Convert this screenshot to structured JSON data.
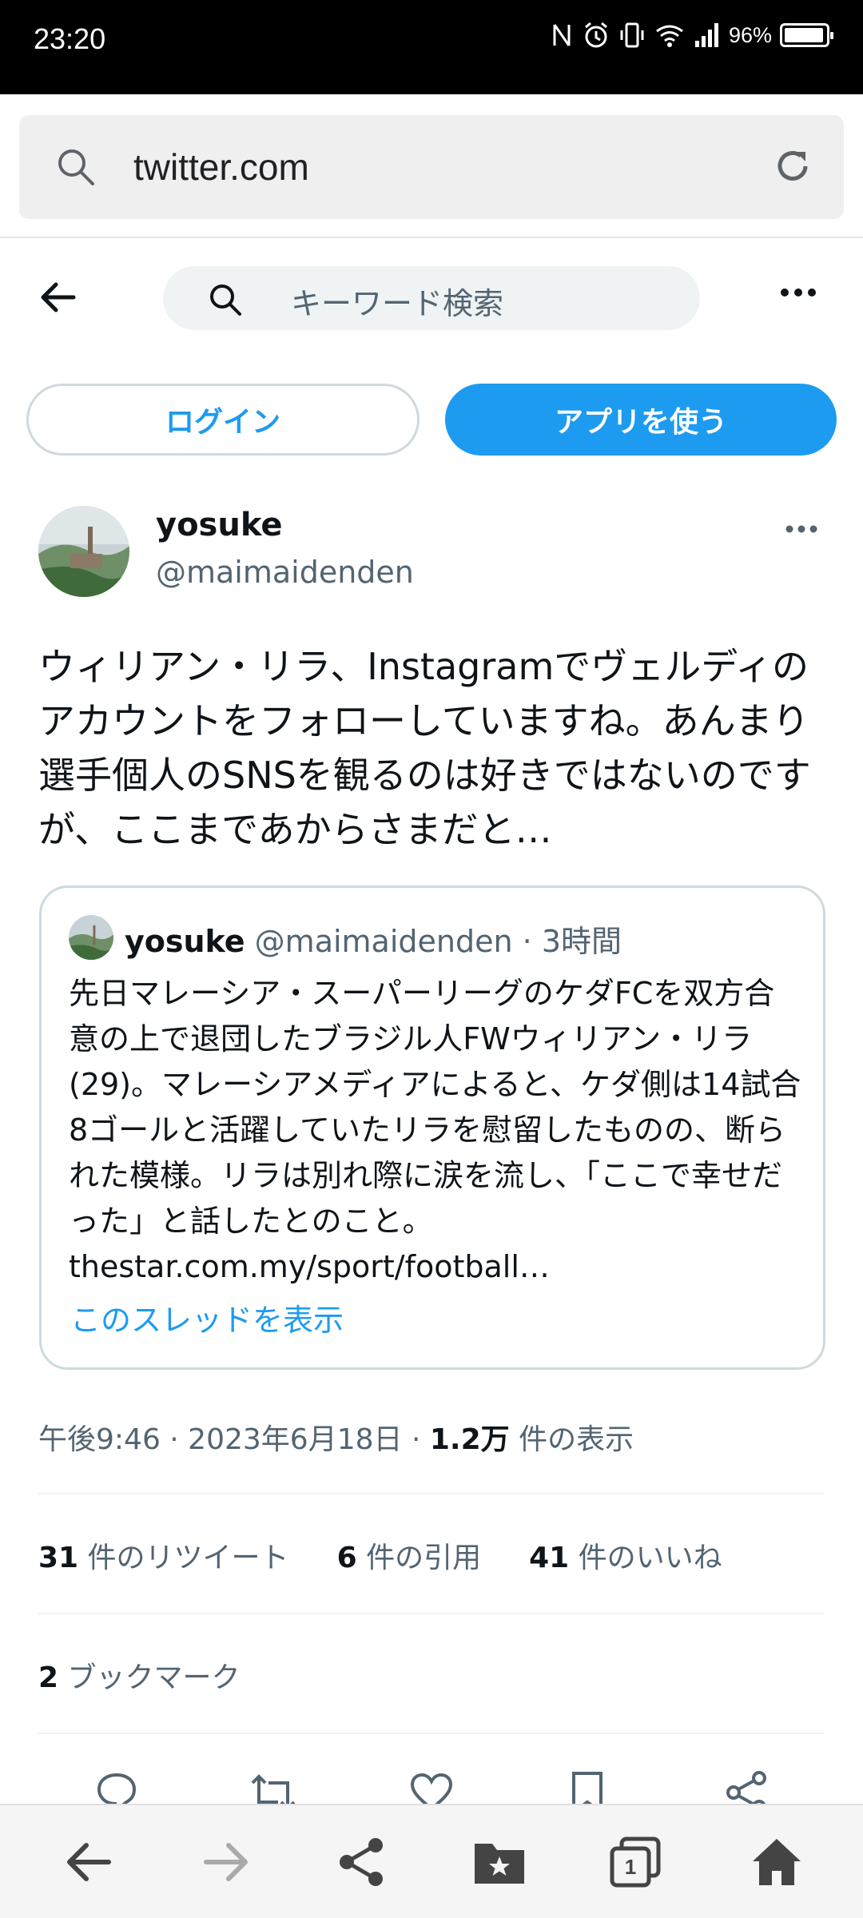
{
  "status_bar": {
    "time": "23:20",
    "battery_percent": "96%",
    "battery_level": 0.96,
    "icons": [
      "nfc-icon",
      "alarm-icon",
      "vibrate-icon",
      "wifi-icon",
      "signal-icon",
      "battery-icon"
    ]
  },
  "browser": {
    "url": "twitter.com",
    "search_icon": "search-icon",
    "reload_icon": "reload-icon",
    "toolbar_icons": [
      "back-icon",
      "forward-icon",
      "share-icon",
      "bookmarks-icon",
      "tabs-icon",
      "home-icon"
    ],
    "tab_count": "1"
  },
  "nav": {
    "search_placeholder": "キーワード検索"
  },
  "buttons": {
    "login": "ログイン",
    "use_app": "アプリを使う"
  },
  "tweet": {
    "author_name": "yosuke",
    "author_handle": "@maimaidenden",
    "text": "ウィリアン・リラ、Instagramでヴェルディのアカウントをフォローしていますね。あんまり選手個人のSNSを観るのは好きではないのですが、ここまであからさまだと…",
    "timestamp": "午後9:46 · 2023年6月18日 · ",
    "views_count": "1.2万",
    "views_label": " 件の表示",
    "retweets_count": "31",
    "retweets_label": " 件のリツイート",
    "quotes_count": "6",
    "quotes_label": " 件の引用",
    "likes_count": "41",
    "likes_label": " 件のいいね",
    "bookmarks_count": "2",
    "bookmarks_label": " ブックマーク"
  },
  "quoted_tweet": {
    "author_name": "yosuke",
    "author_handle": "@maimaidenden",
    "time": "3時間",
    "text": "先日マレーシア・スーパーリーグのケダFCを双方合意の上で退団したブラジル人FWウィリアン・リラ(29)。マレーシアメディアによると、ケダ側は14試合8ゴールと活躍していたリラを慰留したものの、断られた模様。リラは別れ際に涙を流し、「ここで幸せだった」と話したとのこと。thestar.com.my/sport/football…",
    "show_thread": "このスレッドを表示"
  },
  "colors": {
    "accent": "#1d9bf0",
    "secondary_text": "#536471",
    "primary_text": "#0f1419",
    "border": "#cfd9de"
  }
}
